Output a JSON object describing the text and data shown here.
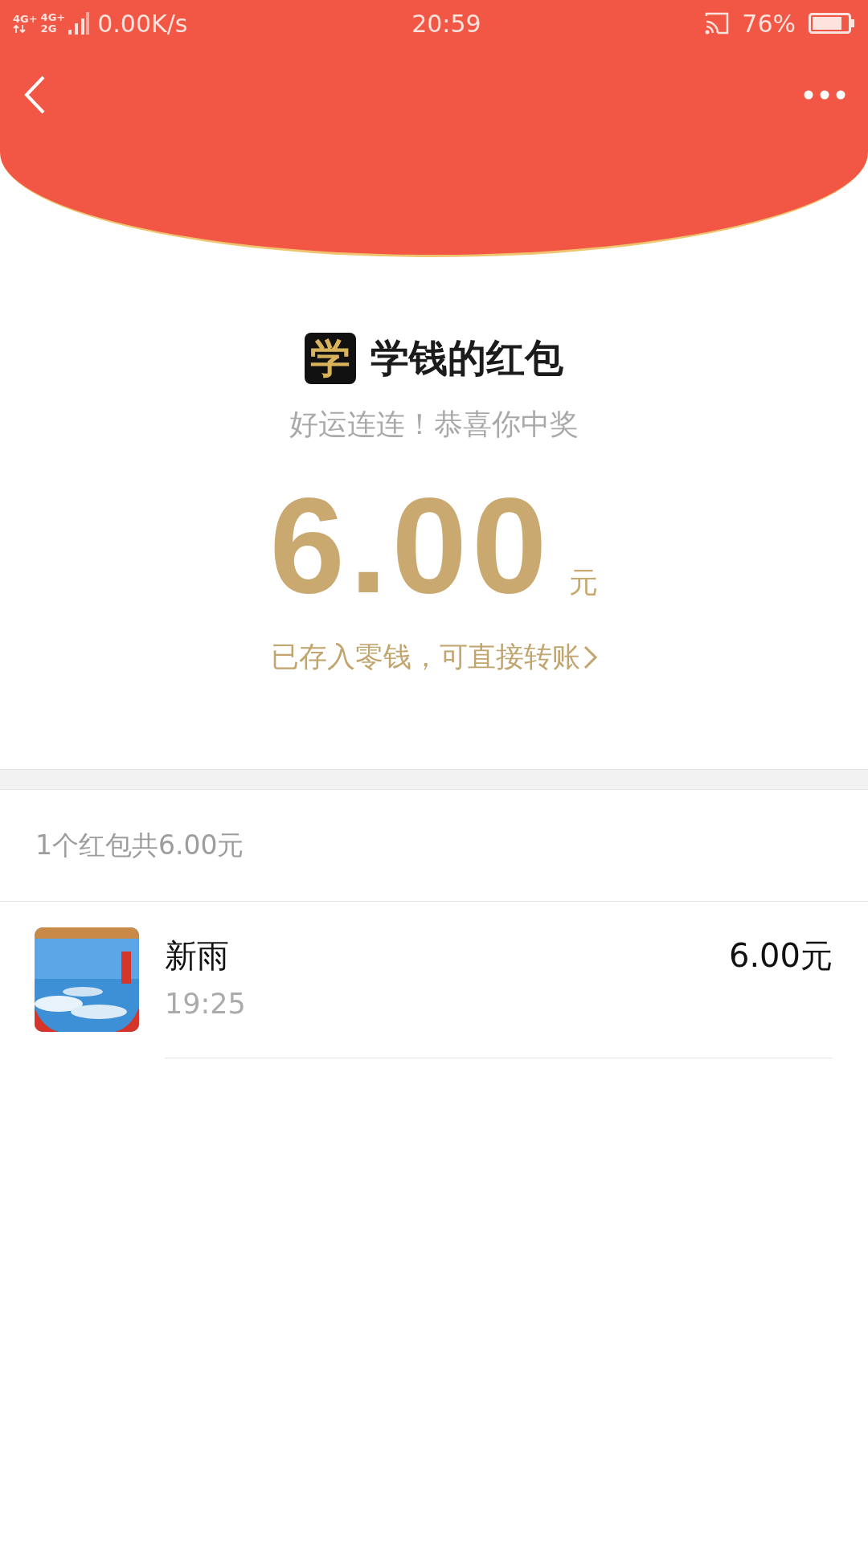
{
  "status_bar": {
    "network_1": "4G+",
    "network_2": "4G+",
    "network_3": "2G",
    "speed": "0.00K/s",
    "time": "20:59",
    "battery": "76%"
  },
  "sender": {
    "logo_glyph": "学",
    "name": "学钱的红包",
    "greeting": "好运连连！恭喜你中奖"
  },
  "amount": {
    "value": "6.00",
    "unit": "元",
    "note": "已存入零钱，可直接转账"
  },
  "summary": "1个红包共6.00元",
  "records": [
    {
      "name": "新雨",
      "time": "19:25",
      "amount": "6.00元"
    }
  ]
}
